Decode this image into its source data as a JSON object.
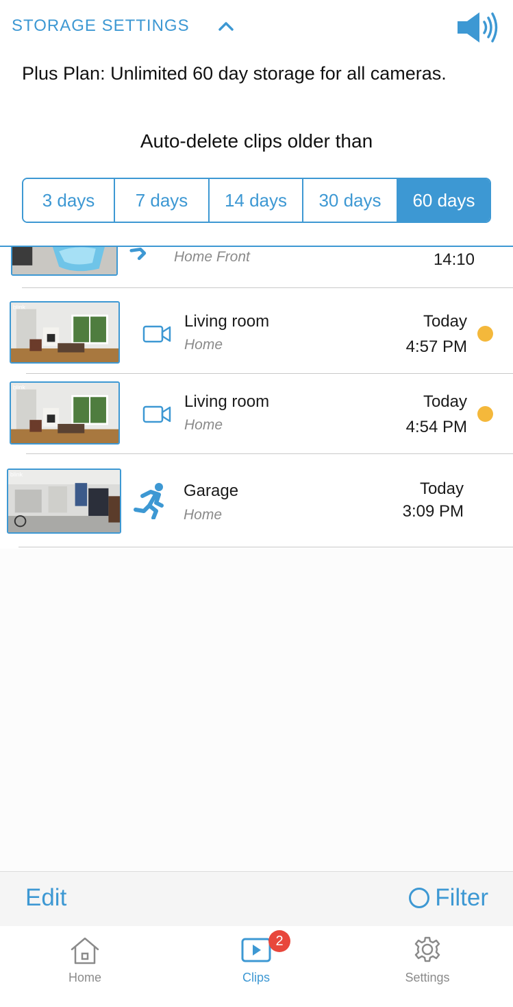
{
  "storage": {
    "title": "STORAGE SETTINGS",
    "plan_text": "Plus Plan: Unlimited 60 day storage for all cameras.",
    "auto_delete_label": "Auto-delete clips older than",
    "options": [
      "3 days",
      "7 days",
      "14 days",
      "30 days",
      "60 days"
    ],
    "selected": "60 days"
  },
  "clips": [
    {
      "title": "",
      "subtitle": "Home Front",
      "day": "",
      "time": "14:10",
      "icon": "motion-icon",
      "unwatched": false
    },
    {
      "title": "Living room",
      "subtitle": "Home",
      "day": "Today",
      "time": "4:57 PM",
      "icon": "video-camera-icon",
      "unwatched": true
    },
    {
      "title": "Living room",
      "subtitle": "Home",
      "day": "Today",
      "time": "4:54 PM",
      "icon": "video-camera-icon",
      "unwatched": true
    },
    {
      "title": "Garage",
      "subtitle": "Home",
      "day": "Today",
      "time": "3:09 PM",
      "icon": "running-person-icon",
      "unwatched": false
    }
  ],
  "toolbar": {
    "edit_label": "Edit",
    "filter_label": "Filter"
  },
  "tabs": [
    {
      "label": "Home",
      "icon": "home-icon"
    },
    {
      "label": "Clips",
      "icon": "clips-play-icon",
      "badge": "2"
    },
    {
      "label": "Settings",
      "icon": "gear-icon"
    }
  ],
  "colors": {
    "accent": "#3d98d3",
    "unwatched_dot": "#f4b83b",
    "badge": "#e8473c"
  }
}
